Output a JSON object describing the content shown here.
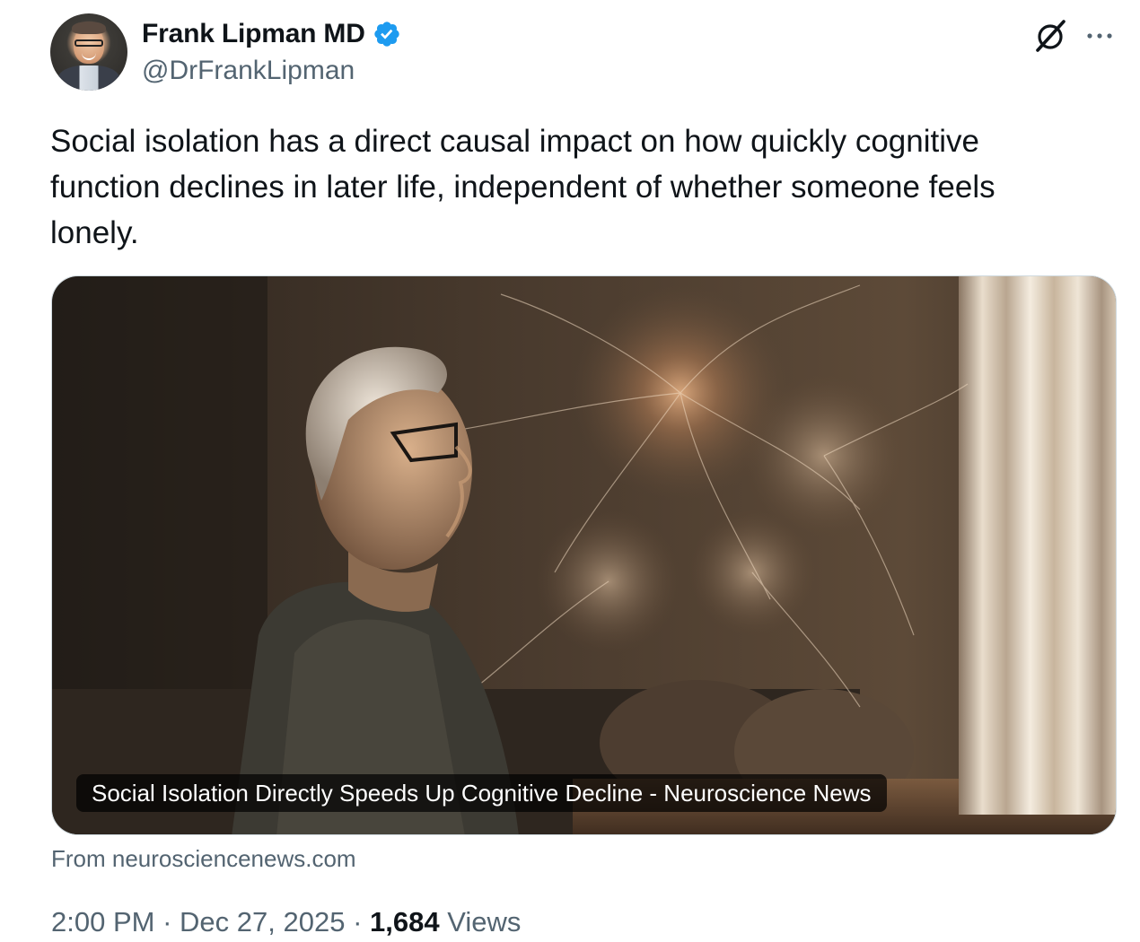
{
  "author": {
    "display_name": "Frank Lipman MD",
    "handle": "@DrFrankLipman",
    "verified": true
  },
  "tweet": {
    "text": "Social isolation has a direct causal impact on how quickly cognitive\nfunction declines in later life, independent of whether someone feels\nlonely."
  },
  "card": {
    "title": "Social Isolation Directly Speeds Up Cognitive Decline - Neuroscience News",
    "source": "From neurosciencenews.com"
  },
  "meta": {
    "time": "2:00 PM",
    "separator": "·",
    "date": "Dec 27, 2025",
    "views_count": "1,684",
    "views_label": "Views"
  },
  "icons": {
    "verified": "verified-badge-icon",
    "grok": "grok-icon",
    "more": "more-dots-icon"
  },
  "colors": {
    "verified_blue": "#1d9bf0",
    "text_primary": "#0f1419",
    "text_secondary": "#536471"
  }
}
